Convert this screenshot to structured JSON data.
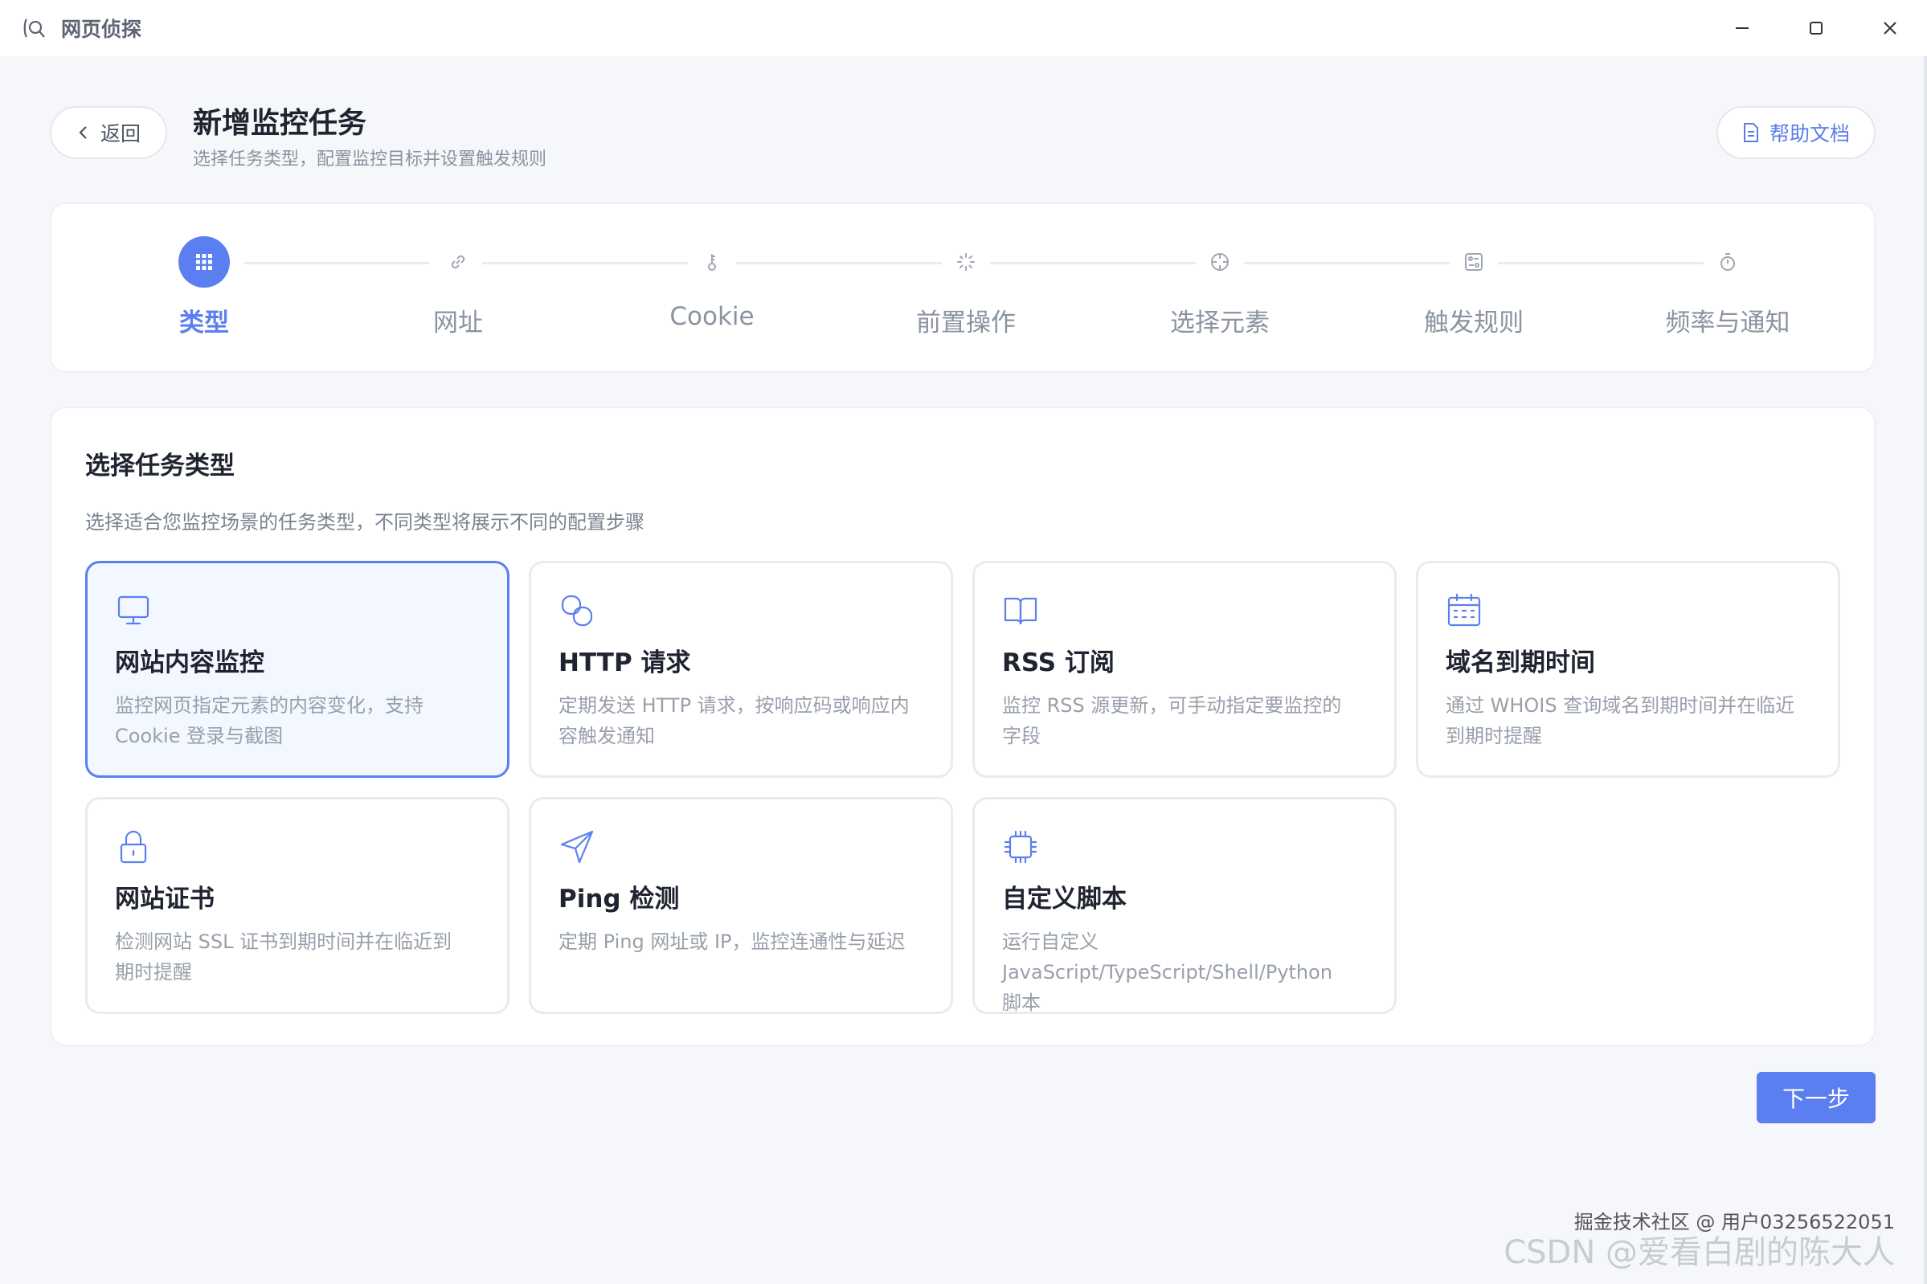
{
  "app": {
    "title": "网页侦探"
  },
  "window": {
    "controls": [
      "minimize-icon",
      "maximize-icon",
      "close-icon"
    ]
  },
  "header": {
    "back_label": "返回",
    "title": "新增监控任务",
    "subtitle": "选择任务类型，配置监控目标并设置触发规则",
    "help_label": "帮助文档"
  },
  "steps": [
    {
      "label": "类型",
      "icon": "grid-icon",
      "active": true
    },
    {
      "label": "网址",
      "icon": "link-icon",
      "active": false
    },
    {
      "label": "Cookie",
      "icon": "key-icon",
      "active": false
    },
    {
      "label": "前置操作",
      "icon": "loader-icon",
      "active": false
    },
    {
      "label": "选择元素",
      "icon": "crosshair-icon",
      "active": false
    },
    {
      "label": "触发规则",
      "icon": "rules-icon",
      "active": false
    },
    {
      "label": "频率与通知",
      "icon": "timer-icon",
      "active": false
    }
  ],
  "section": {
    "title": "选择任务类型",
    "subtitle": "选择适合您监控场景的任务类型，不同类型将展示不同的配置步骤"
  },
  "task_types": [
    {
      "title": "网站内容监控",
      "desc": "监控网页指定元素的内容变化，支持 Cookie 登录与截图",
      "icon": "monitor-icon",
      "selected": true
    },
    {
      "title": "HTTP 请求",
      "desc": "定期发送 HTTP 请求，按响应码或响应内容触发通知",
      "icon": "request-icon",
      "selected": false
    },
    {
      "title": "RSS 订阅",
      "desc": "监控 RSS 源更新，可手动指定要监控的字段",
      "icon": "book-icon",
      "selected": false
    },
    {
      "title": "域名到期时间",
      "desc": "通过 WHOIS 查询域名到期时间并在临近到期时提醒",
      "icon": "calendar-icon",
      "selected": false
    },
    {
      "title": "网站证书",
      "desc": "检测网站 SSL 证书到期时间并在临近到期时提醒",
      "icon": "lock-icon",
      "selected": false
    },
    {
      "title": "Ping 检测",
      "desc": "定期 Ping 网址或 IP，监控连通性与延迟",
      "icon": "send-icon",
      "selected": false
    },
    {
      "title": "自定义脚本",
      "desc": "运行自定义 JavaScript/TypeScript/Shell/Python 脚本",
      "icon": "chip-icon",
      "selected": false
    }
  ],
  "footer": {
    "next_label": "下一步"
  },
  "watermark": {
    "line1": "掘金技术社区 @ 用户03256522051",
    "line2": "CSDN @爱看白剧的陈大人"
  },
  "colors": {
    "accent": "#5b7ff0",
    "background": "#f5f7fa"
  }
}
